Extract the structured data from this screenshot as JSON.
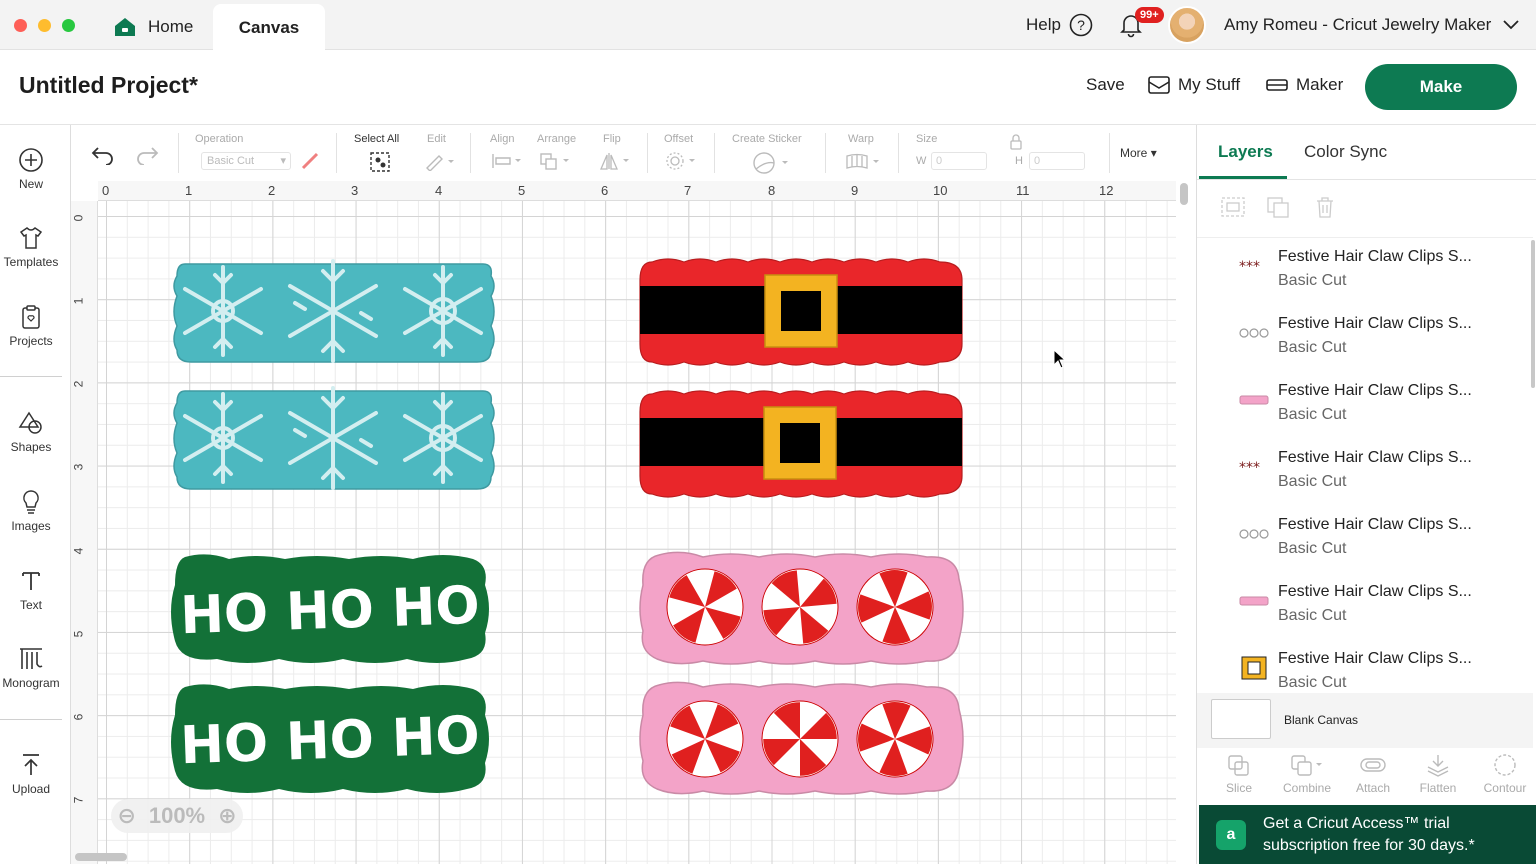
{
  "titlebar": {
    "home_tab": "Home",
    "canvas_tab": "Canvas",
    "help": "Help",
    "notifications_badge": "99+",
    "account_name": "Amy Romeu - Cricut Jewelry Maker",
    "window_dot_colors": [
      "#fe5f57",
      "#febc2e",
      "#28c840"
    ]
  },
  "header": {
    "project_title": "Untitled Project*",
    "save": "Save",
    "my_stuff": "My Stuff",
    "machine": "Maker",
    "make": "Make",
    "accent_color": "#0d7a52"
  },
  "sidebar": {
    "items": [
      {
        "label": "New",
        "icon": "plus-circle-icon"
      },
      {
        "label": "Templates",
        "icon": "tshirt-icon"
      },
      {
        "label": "Projects",
        "icon": "clipboard-icon"
      },
      {
        "label": "Shapes",
        "icon": "shapes-icon"
      },
      {
        "label": "Images",
        "icon": "lightbulb-icon"
      },
      {
        "label": "Text",
        "icon": "text-icon"
      },
      {
        "label": "Monogram",
        "icon": "monogram-icon"
      },
      {
        "label": "Upload",
        "icon": "upload-icon"
      }
    ]
  },
  "toolbar": {
    "operation_label": "Operation",
    "operation_value": "Basic Cut",
    "select_all": "Select All",
    "edit": "Edit",
    "align": "Align",
    "arrange": "Arrange",
    "flip": "Flip",
    "offset": "Offset",
    "create_sticker": "Create Sticker",
    "warp": "Warp",
    "size": "Size",
    "w_label": "W",
    "h_label": "H",
    "w_value": "0",
    "h_value": "0",
    "more": "More"
  },
  "canvas": {
    "ruler_x": [
      "0",
      "1",
      "2",
      "3",
      "4",
      "5",
      "6",
      "7",
      "8",
      "9",
      "10",
      "11",
      "12"
    ],
    "ruler_y": [
      "0",
      "1",
      "2",
      "3",
      "4",
      "5",
      "6",
      "7"
    ],
    "zoom": "100%",
    "hoho_text": "HO HO HO",
    "colors": {
      "teal": "#4cb8c0",
      "snow": "#d3eef0",
      "santa_red": "#e9262a",
      "belt_black": "#000000",
      "buckle": "#f3b321",
      "hoho_green": "#137138",
      "candy_pink": "#f3a3c8",
      "candy_red": "#e0201f"
    }
  },
  "layers_panel": {
    "tabs": [
      "Layers",
      "Color Sync"
    ],
    "layers": [
      {
        "name": "Festive Hair Claw Clips S...",
        "op": "Basic Cut",
        "thumb": "dots-dark"
      },
      {
        "name": "Festive Hair Claw Clips S...",
        "op": "Basic Cut",
        "thumb": "rings-outline"
      },
      {
        "name": "Festive Hair Claw Clips S...",
        "op": "Basic Cut",
        "thumb": "pink-bar"
      },
      {
        "name": "Festive Hair Claw Clips S...",
        "op": "Basic Cut",
        "thumb": "dots-dark"
      },
      {
        "name": "Festive Hair Claw Clips S...",
        "op": "Basic Cut",
        "thumb": "rings-outline"
      },
      {
        "name": "Festive Hair Claw Clips S...",
        "op": "Basic Cut",
        "thumb": "pink-bar"
      },
      {
        "name": "Festive Hair Claw Clips S...",
        "op": "Basic Cut",
        "thumb": "buckle"
      }
    ],
    "blank_canvas": "Blank Canvas",
    "tools": [
      "Slice",
      "Combine",
      "Attach",
      "Flatten",
      "Contour"
    ],
    "promo": "Get a Cricut Access™ trial subscription free for 30 days.*",
    "promo_icon_letter": "a"
  }
}
